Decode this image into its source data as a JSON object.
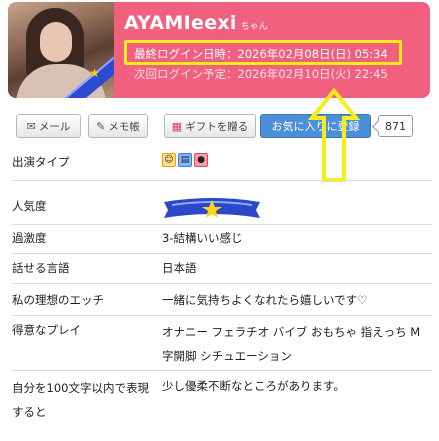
{
  "header": {
    "name": "AYAMIeexi",
    "name_suffix": "ちゃん",
    "last_login": "最終ログイン日時：2026年02月08日(日) 05:34",
    "next_login": "次回ログイン予定：2026年02月10日(火) 22:45"
  },
  "buttons": {
    "mail": "メール",
    "memo": "メモ帳",
    "gift": "ギフトを贈る",
    "favorite": "お気に入りに登録",
    "favorite_count": "871"
  },
  "colors": {
    "header_bg": "#f2607f",
    "highlight_box": "#f6ee18",
    "favorite_button": "#4d8fd6"
  },
  "profile": {
    "rows": [
      {
        "label": "出演タイプ",
        "value": ""
      },
      {
        "label": "人気度",
        "value": ""
      },
      {
        "label": "過激度",
        "value": "3-結構いい感じ"
      },
      {
        "label": "話せる言語",
        "value": "日本語"
      },
      {
        "label": "私の理想のエッチ",
        "value": "一緒に気持ちよくなれたら嬉しいです♡"
      },
      {
        "label": "得意なプレイ",
        "value": "オナニー フェラチオ バイブ おもちゃ 指えっち M字開脚 シチュエーション"
      },
      {
        "label": "自分を100文字以内で表現すると",
        "value": "少し優柔不断なところがあります。"
      }
    ],
    "type_icons": [
      "face-icon",
      "book-icon",
      "video-icon"
    ],
    "popularity_icon": "star-ribbon-icon"
  }
}
